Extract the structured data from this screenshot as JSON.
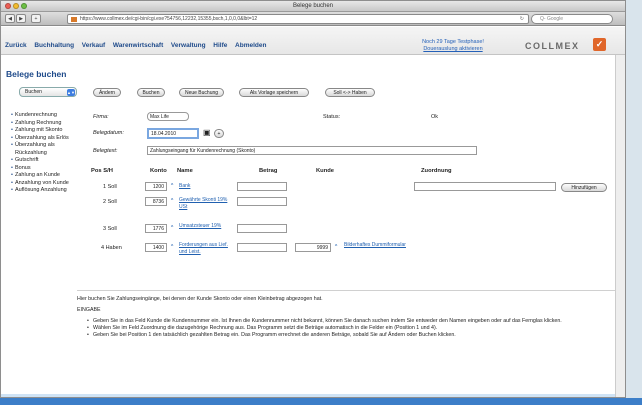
{
  "window": {
    "title": "Belege buchen"
  },
  "toolbar": {
    "url": "https://www.collmex.de/cgi-bin/cgi.exe?54756,12232,15355,bsch,1,0,0,0&lbt=12",
    "search_placeholder": "Q- Google"
  },
  "menu": {
    "items": [
      "Zurück",
      "Buchhaltung",
      "Verkauf",
      "Warenwirtschaft",
      "Verwaltung",
      "Hilfe",
      "Abmelden"
    ],
    "trial_line1": "Noch 29 Tage Testphase!",
    "trial_line2": "Douerauslung aktivieren",
    "logo": "COLLMEX"
  },
  "page": {
    "title": "Belege buchen"
  },
  "actions": {
    "select_value": "Buchen",
    "buttons": [
      "Ändern",
      "Buchen",
      "Neue Buchung",
      "Als Vorlage speichern",
      "Soll <-> Haben"
    ]
  },
  "sidebar": {
    "items": [
      "Kundenrechnung",
      "Zahlung Rechnung",
      "Zahlung mit Skonto",
      "Überzahlung als Erlös",
      "Überzahlung als Rückzahlung",
      "Gutschrift",
      "Bonus",
      "Zahlung an Kunde",
      "Anzahlung von Kunde",
      "Auflösung Anzahlung"
    ]
  },
  "form": {
    "firma_label": "Firma:",
    "firma_value": "Max Life",
    "status_label": "Status:",
    "status_value": "Ok",
    "datum_label": "Belegdatum:",
    "datum_value": "18.04.2010",
    "text_label": "Belegtext:",
    "text_value": "Zahlungseingang für Kundenrechnung (Skonto)"
  },
  "table": {
    "headers": [
      "Pos S/H",
      "Konto",
      "Name",
      "Betrag",
      "Kunde",
      "Zuordnung"
    ],
    "rows": [
      {
        "pos": "1 Soll",
        "konto": "1200",
        "name": "Bank"
      },
      {
        "pos": "2 Soll",
        "konto": "8736",
        "name": "Gewährte Skonti 19% USt"
      },
      {
        "pos": "3 Soll",
        "konto": "1776",
        "name": "Umsatzsteuer 19%"
      },
      {
        "pos": "4 Haben",
        "konto": "1400",
        "name": "Forderungen aus Lief. und Leist.",
        "kunde": "9999",
        "kunde_name": "Bilderhaftes Dummiformular"
      }
    ],
    "hinzufuegen": "Hinzufügen"
  },
  "info": {
    "intro": "Hier buchen Sie Zahlungseingänge, bei denen der Kunde Skonto oder einen Kleinbetrag abgezogen hat.",
    "heading": "EINGABE",
    "bullets": [
      "Geben Sie in das Feld Kunde die Kundennummer ein. Ist Ihnen die Kundennummer nicht bekannt, können Sie danach suchen indem Sie entweder den Namen eingeben oder auf das Fernglas klicken.",
      "Wählen Sie im Feld Zuordnung die dazugehörige Rechnung aus. Das Programm setzt die Beträge automatisch in die Felder ein (Position 1 und 4).",
      "Geben Sie bei Position 1 den tatsächlich gezahlten Betrag ein. Das Programm errechnet die anderen Beträge, sobald Sie auf Ändern oder Buchen klicken."
    ]
  }
}
